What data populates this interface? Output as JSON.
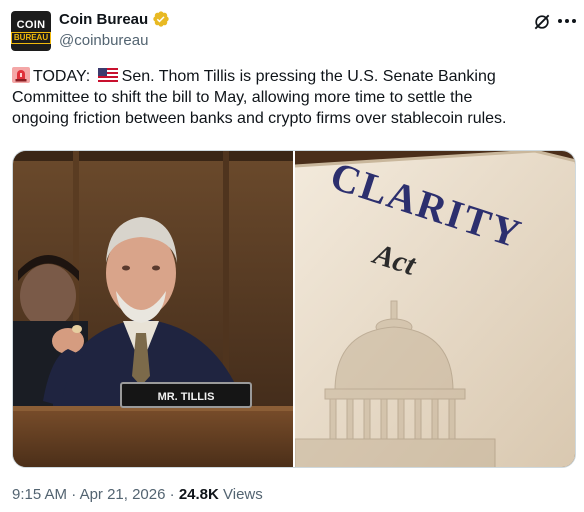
{
  "author": {
    "avatar_text_top": "COIN",
    "avatar_text_bottom": "BUREAU",
    "display_name": "Coin Bureau",
    "handle": "@coinbureau",
    "verified_color": "#e8b923"
  },
  "actions": {
    "grok_icon": "grok-icon",
    "more_icon": "more-icon"
  },
  "tweet": {
    "line1_prefix": "TODAY:",
    "line1_rest": "Sen. Thom Tillis is pressing the U.S. Senate Banking",
    "line2": "Committee to shift the bill to May, allowing more time to settle the",
    "line3": "ongoing friction between banks and crypto firms over stablecoin rules."
  },
  "media": {
    "left_nameplate": "MR. TILLIS",
    "right_title": "CLARITY",
    "right_subtitle": "Act"
  },
  "meta": {
    "time": "9:15 AM",
    "separator1": " · ",
    "date": "Apr 21, 2026",
    "separator2": " · ",
    "views_count": "24.8K",
    "views_label": " Views"
  }
}
